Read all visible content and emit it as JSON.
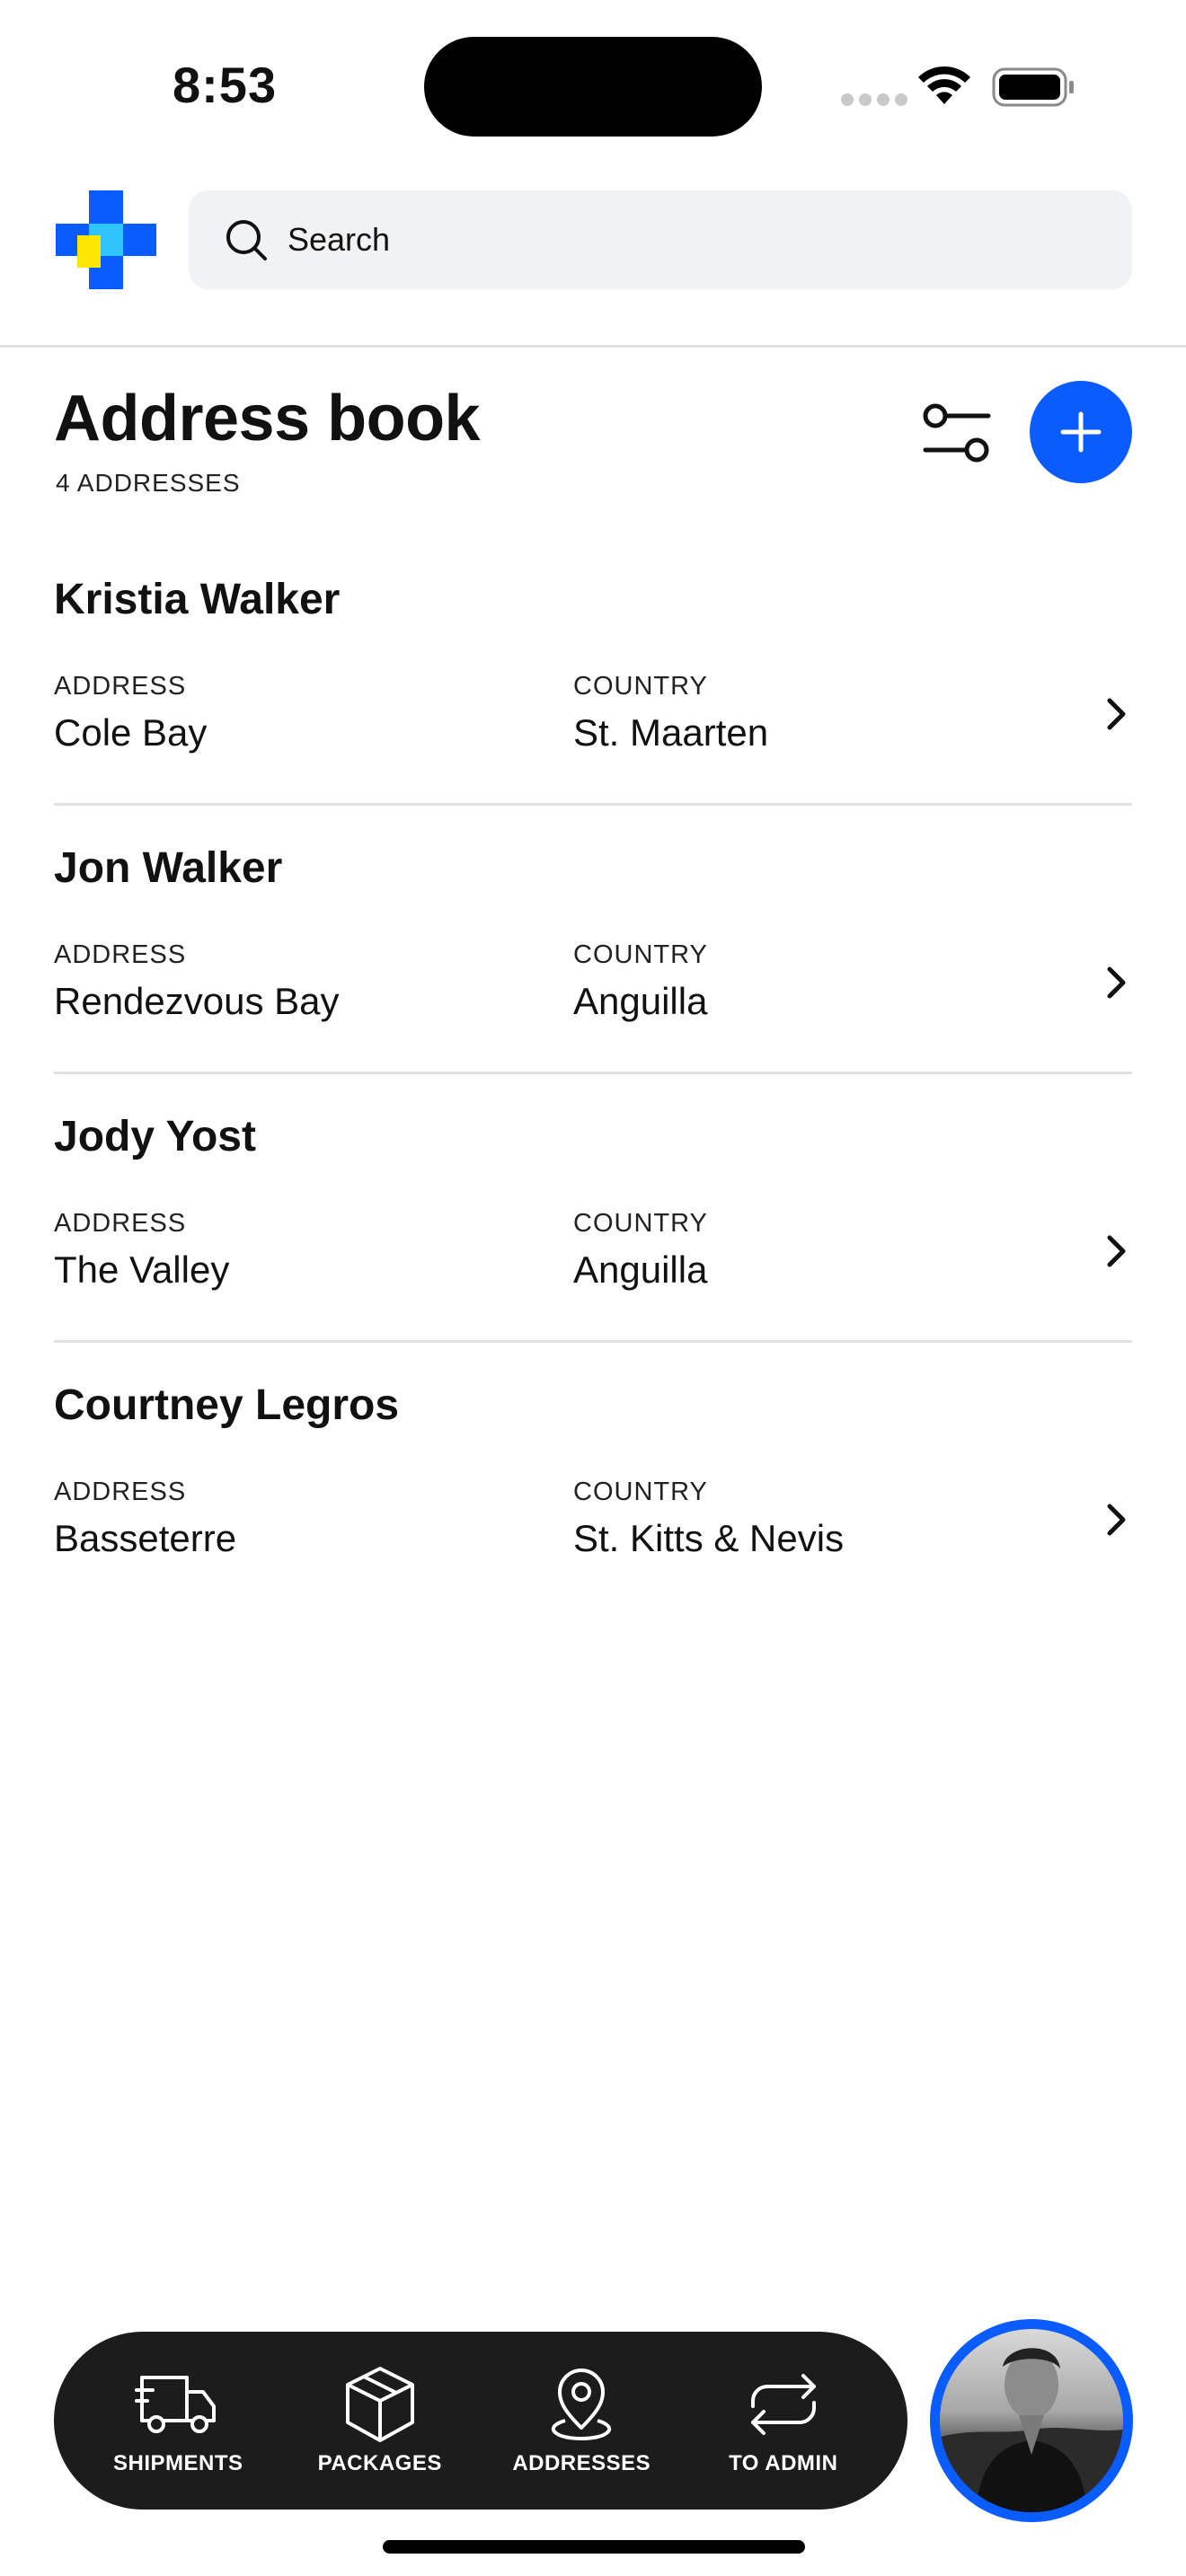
{
  "status_bar": {
    "time": "8:53"
  },
  "header": {
    "search_placeholder": "Search"
  },
  "page": {
    "title": "Address book",
    "subtitle": "4 ADDRESSES"
  },
  "addresses": [
    {
      "name": "Kristia Walker",
      "address_label": "ADDRESS",
      "address": "Cole Bay",
      "country_label": "COUNTRY",
      "country": "St. Maarten"
    },
    {
      "name": "Jon Walker",
      "address_label": "ADDRESS",
      "address": "Rendezvous Bay",
      "country_label": "COUNTRY",
      "country": "Anguilla"
    },
    {
      "name": "Jody Yost",
      "address_label": "ADDRESS",
      "address": "The Valley",
      "country_label": "COUNTRY",
      "country": "Anguilla"
    },
    {
      "name": "Courtney Legros",
      "address_label": "ADDRESS",
      "address": "Basseterre",
      "country_label": "COUNTRY",
      "country": "St. Kitts & Nevis"
    }
  ],
  "nav": {
    "items": [
      {
        "label": "SHIPMENTS",
        "icon": "truck-icon"
      },
      {
        "label": "PACKAGES",
        "icon": "package-icon"
      },
      {
        "label": "ADDRESSES",
        "icon": "map-pin-icon"
      },
      {
        "label": "TO ADMIN",
        "icon": "switch-arrows-icon"
      }
    ]
  },
  "colors": {
    "accent": "#0b5cff",
    "nav_background": "#1c1c1c",
    "search_background": "#f1f2f4"
  }
}
